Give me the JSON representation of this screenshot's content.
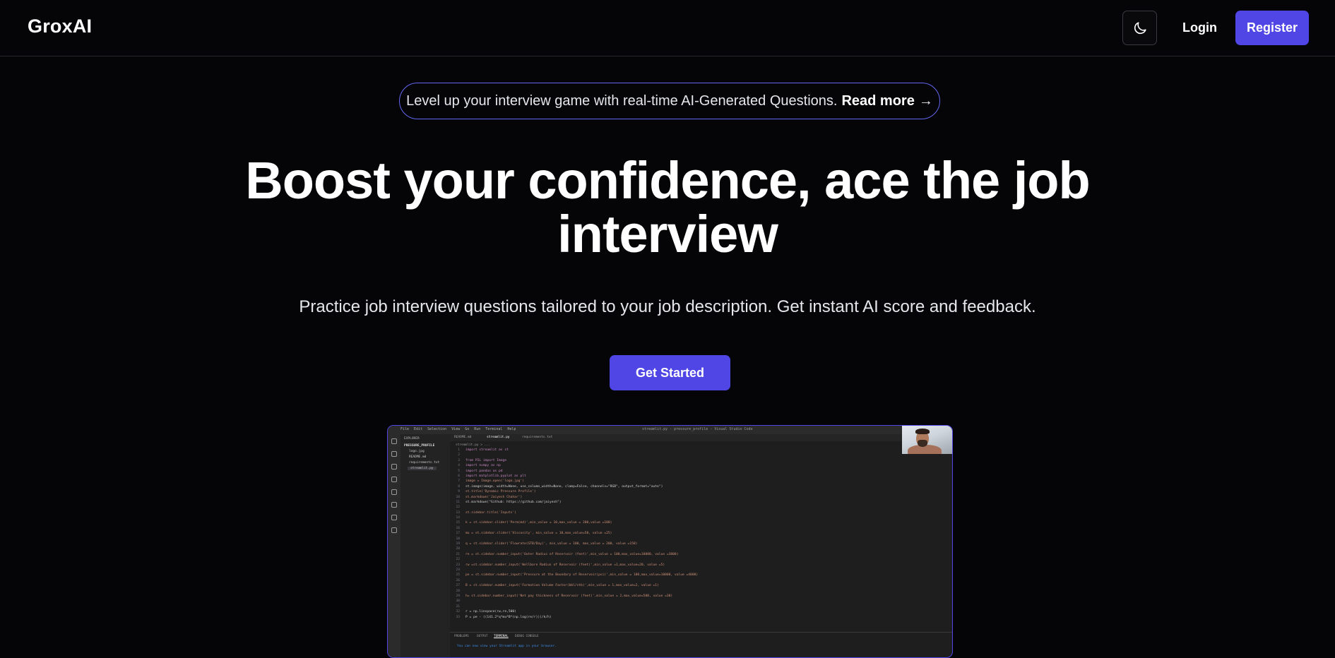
{
  "brand": {
    "name": "GroxAI"
  },
  "nav": {
    "theme_toggle_icon": "moon-icon",
    "login_label": "Login",
    "register_label": "Register"
  },
  "announcement": {
    "text": "Level up your interview game with real-time AI-Generated Questions.",
    "link_label": "Read more",
    "arrow": "→"
  },
  "hero": {
    "title": "Boost your confidence, ace the job interview",
    "subtitle": "Practice job interview questions tailored to your job description. Get instant AI score and feedback.",
    "cta_label": "Get Started"
  },
  "colors": {
    "background": "#050507",
    "accent": "#4f46e5",
    "pill_border": "#6366f1"
  },
  "preview": {
    "menu": [
      "File",
      "Edit",
      "Selection",
      "View",
      "Go",
      "Run",
      "Terminal",
      "Help"
    ],
    "window_title": "streamlit.py - pressure_profile - Visual Studio Code",
    "explorer_title": "EXPLORER",
    "folder": "PRESSURE_PROFILE",
    "files": [
      "logo.jpg",
      "README.md",
      "requirements.txt",
      "streamlit.py"
    ],
    "tabs": [
      "README.md",
      "streamlit.py",
      "requirements.txt"
    ],
    "breadcrumb": "streamlit.py > ...",
    "code_lines": [
      "import streamlit as st",
      "",
      "from PIL import Image",
      "import numpy as np",
      "import pandas as pd",
      "import matplotlib.pyplot as plt",
      "image = Image.open('logo.jpg')",
      "st.image(image, width=None, use_column_width=None, clamp=False, channels=\"RGB\", output_format=\"auto\")",
      "st.title('Dynamic Pressure Profile')",
      "st.markdown('Jaiyesh Chahar')",
      "st.markdown(\"Github: https://github.com/jaiyesh\")",
      "",
      "st.sidebar.title('Inputs')",
      "",
      "k = st.sidebar.slider('Perm(md)',min_value = 10,max_value = 200,value =100)",
      "",
      "mu = st.sidebar.slider('Viscosity', min_value = 10,max_value=50, value =25)",
      "",
      "q = st.sidebar.slider('Flowrate(STB/Day)', min_value = 100, max_value = 200, value =150)",
      "",
      "re = st.sidebar.number_input('Outer Radius of Reservoir (feet)',min_value = 100,max_value=10000, value =3000)",
      "",
      "rw =st.sidebar.number_input('Wellbore Radius of Reservoir (feet)',min_value =1,max_value=20, value =5)",
      "",
      "pe = st.sidebar.number_input('Pressure at the Boundary of Reservoir(psi)',min_value = 100,max_value=10000, value =4000)",
      "",
      "B = st.sidebar.number_input('Formation Volume Factor(bbl/stb)',min_value = 1,max_value=2, value =1)",
      "",
      "h= st.sidebar.number_input('Net pay thickness of Reservoir (feet)',min_value = 2,max_value=500, value =30)",
      "",
      "",
      "r = np.linspace(rw,re,500)",
      "P = pe - ((141.2*q*mu*B*(np.log(re/r)))/k/h)"
    ],
    "panel_tabs": [
      "PROBLEMS",
      "OUTPUT",
      "TERMINAL",
      "DEBUG CONSOLE"
    ],
    "terminal_text": "You can now view your Streamlit app in your browser."
  }
}
